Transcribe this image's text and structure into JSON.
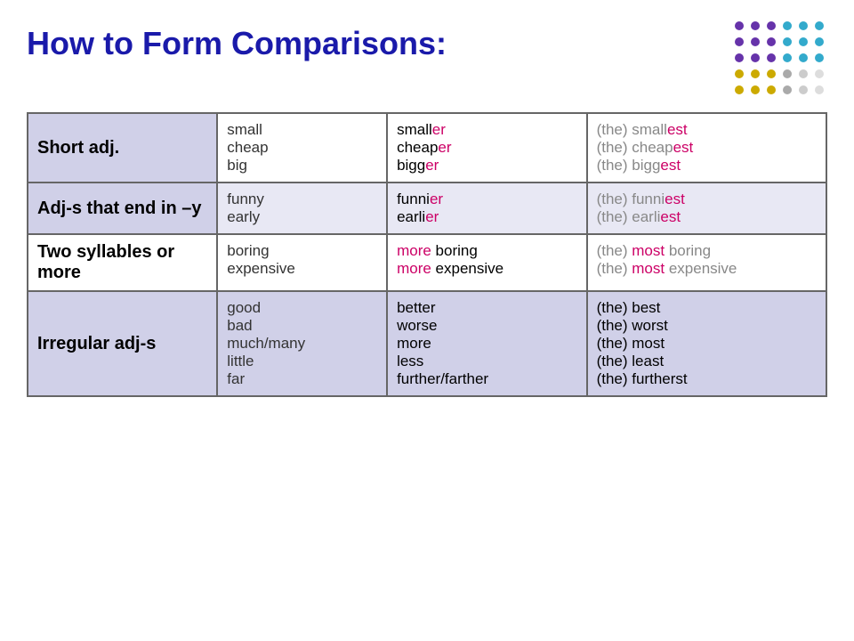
{
  "title": "How to Form Comparisons:",
  "dots": [
    {
      "color": "#6633aa"
    },
    {
      "color": "#6633aa"
    },
    {
      "color": "#6633aa"
    },
    {
      "color": "#33aacc"
    },
    {
      "color": "#33aacc"
    },
    {
      "color": "#33aacc"
    },
    {
      "color": "#6633aa"
    },
    {
      "color": "#6633aa"
    },
    {
      "color": "#6633aa"
    },
    {
      "color": "#33aacc"
    },
    {
      "color": "#33aacc"
    },
    {
      "color": "#33aacc"
    },
    {
      "color": "#6633aa"
    },
    {
      "color": "#6633aa"
    },
    {
      "color": "#6633aa"
    },
    {
      "color": "#33aacc"
    },
    {
      "color": "#33aacc"
    },
    {
      "color": "#33aacc"
    },
    {
      "color": "#ccaa00"
    },
    {
      "color": "#ccaa00"
    },
    {
      "color": "#ccaa00"
    },
    {
      "color": "#aaaaaa"
    },
    {
      "color": "#cccccc"
    },
    {
      "color": "#dddddd"
    },
    {
      "color": "#ccaa00"
    },
    {
      "color": "#ccaa00"
    },
    {
      "color": "#ccaa00"
    },
    {
      "color": "#aaaaaa"
    },
    {
      "color": "#cccccc"
    },
    {
      "color": "#dddddd"
    }
  ],
  "rows": [
    {
      "id": "short",
      "category": "Short adj.",
      "base": [
        "small",
        "cheap",
        "big"
      ],
      "comparative": [
        {
          "text": "smaller",
          "pink_start": 6
        },
        {
          "text": "cheaper",
          "pink_start": 6
        },
        {
          "text": "bigger",
          "pink_start": 4
        }
      ],
      "superlative": [
        {
          "prefix": "(the) small",
          "suffix": "est"
        },
        {
          "prefix": "(the) cheap",
          "suffix": "est"
        },
        {
          "prefix": "(the) bigg",
          "suffix": "est"
        }
      ]
    },
    {
      "id": "adjy",
      "category": "Adj-s that end in –y",
      "base": [
        "funny",
        "early"
      ],
      "comparative": [
        {
          "text": "funnier",
          "pink_start": 5
        },
        {
          "text": "earlier",
          "pink_start": 5
        }
      ],
      "superlative": [
        {
          "prefix": "(the) funni",
          "suffix": "est"
        },
        {
          "prefix": "(the) earli",
          "suffix": "est"
        }
      ]
    },
    {
      "id": "two",
      "category": "Two syllables or more",
      "base": [
        "boring",
        "expensive"
      ],
      "comparative": [
        {
          "pink_word": "more",
          "rest": " boring"
        },
        {
          "pink_word": "more",
          "rest": " expensive"
        }
      ],
      "superlative": [
        {
          "prefix": "(the) ",
          "pink_word": "most",
          "rest": " boring"
        },
        {
          "prefix": "(the) ",
          "pink_word": "most",
          "rest": " expensive"
        }
      ]
    },
    {
      "id": "irreg",
      "category": "Irregular adj-s",
      "base": [
        "good",
        "bad",
        "much/many",
        "little",
        "far"
      ],
      "comparative": [
        "better",
        "worse",
        "more",
        "less",
        "further/farther"
      ],
      "superlative": [
        "(the) best",
        "(the) worst",
        "(the) most",
        "(the) least",
        "(the) furtherst"
      ]
    }
  ]
}
